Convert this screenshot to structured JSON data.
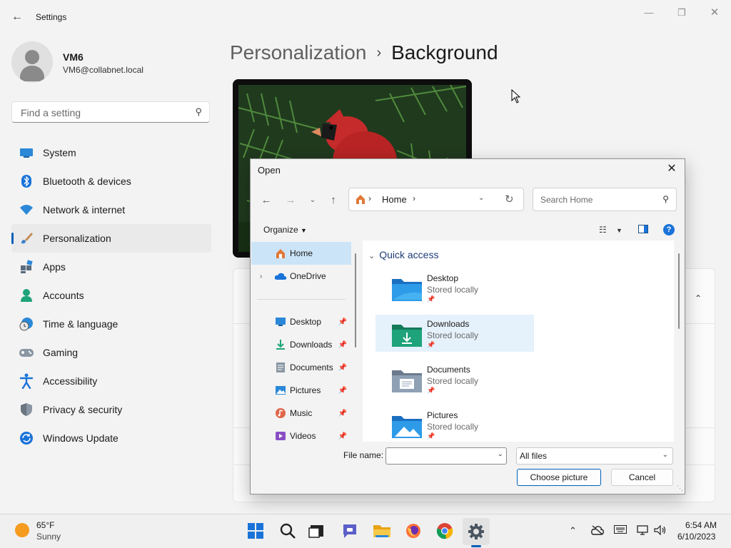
{
  "window": {
    "title": "Settings"
  },
  "user": {
    "name": "VM6",
    "email": "VM6@collabnet.local"
  },
  "search": {
    "placeholder": "Find a setting"
  },
  "nav": {
    "items": [
      {
        "label": "System",
        "icon": "system-icon"
      },
      {
        "label": "Bluetooth & devices",
        "icon": "bluetooth-icon"
      },
      {
        "label": "Network & internet",
        "icon": "wifi-icon"
      },
      {
        "label": "Personalization",
        "icon": "brush-icon",
        "active": true
      },
      {
        "label": "Apps",
        "icon": "apps-icon"
      },
      {
        "label": "Accounts",
        "icon": "accounts-icon"
      },
      {
        "label": "Time & language",
        "icon": "clock-globe-icon"
      },
      {
        "label": "Gaming",
        "icon": "gamepad-icon"
      },
      {
        "label": "Accessibility",
        "icon": "accessibility-icon"
      },
      {
        "label": "Privacy & security",
        "icon": "shield-icon"
      },
      {
        "label": "Windows Update",
        "icon": "update-icon"
      }
    ]
  },
  "breadcrumb": {
    "parent": "Personalization",
    "separator": "›",
    "current": "Background"
  },
  "dialog": {
    "title": "Open",
    "address": {
      "location": "Home",
      "separator": "›"
    },
    "search_placeholder": "Search Home",
    "organize_label": "Organize",
    "nav_pane": {
      "items": [
        {
          "label": "Home",
          "icon": "home-icon",
          "selected": true
        },
        {
          "label": "OneDrive",
          "icon": "cloud-icon",
          "expandable": true
        },
        {
          "label": "Desktop",
          "icon": "desktop-icon",
          "pinned": true
        },
        {
          "label": "Downloads",
          "icon": "download-icon",
          "pinned": true
        },
        {
          "label": "Documents",
          "icon": "document-icon",
          "pinned": true
        },
        {
          "label": "Pictures",
          "icon": "pictures-icon",
          "pinned": true
        },
        {
          "label": "Music",
          "icon": "music-icon",
          "pinned": true
        },
        {
          "label": "Videos",
          "icon": "videos-icon",
          "pinned": true
        }
      ]
    },
    "quick_access": {
      "heading": "Quick access",
      "items": [
        {
          "name": "Desktop",
          "status": "Stored locally"
        },
        {
          "name": "Downloads",
          "status": "Stored locally",
          "selected": true
        },
        {
          "name": "Documents",
          "status": "Stored locally"
        },
        {
          "name": "Pictures",
          "status": "Stored locally"
        }
      ]
    },
    "file_name_label": "File name:",
    "file_name_value": "",
    "file_type": "All files",
    "choose_label": "Choose picture",
    "cancel_label": "Cancel"
  },
  "taskbar": {
    "weather": {
      "temp": "65°F",
      "condition": "Sunny"
    },
    "apps": [
      "start-icon",
      "search-icon",
      "task-view-icon",
      "teams-chat-icon",
      "file-explorer-icon",
      "firefox-icon",
      "chrome-icon",
      "settings-icon"
    ],
    "clock": {
      "time": "6:54 AM",
      "date": "6/10/2023"
    }
  },
  "colors": {
    "accent": "#005fb8",
    "selection": "#cce4f7",
    "folder_blue": "#2d8fd6",
    "folder_green": "#1ea37a"
  }
}
